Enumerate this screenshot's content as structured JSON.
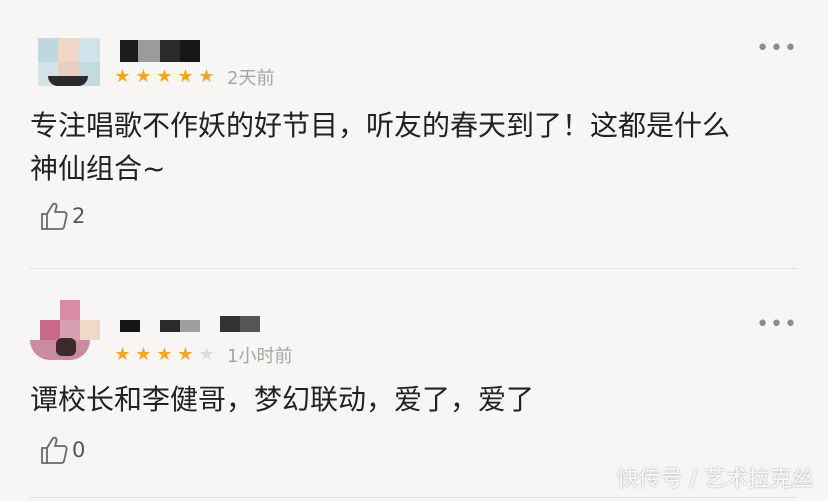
{
  "comments": [
    {
      "rating_filled": 5,
      "rating_total": 5,
      "time": "2天前",
      "content_line1": "专注唱歌不作妖的好节目，听友的春天到了！这都是什么",
      "content_line2": "神仙组合~",
      "likes": "2"
    },
    {
      "rating_filled": 4,
      "rating_total": 5,
      "time": "1小时前",
      "content_line1": "谭校长和李健哥，梦幻联动，爱了，爱了",
      "likes": "0"
    }
  ],
  "icons": {
    "more": "more-dots-icon",
    "like": "thumbs-up-icon",
    "star": "star-icon"
  },
  "colors": {
    "star_on": "#f5a524",
    "star_off": "#dedcd8",
    "muted": "#a7a5a2"
  },
  "watermark": "快传号 / 艺术拉克丝"
}
